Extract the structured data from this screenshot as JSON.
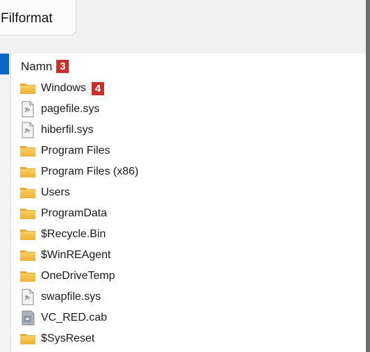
{
  "tab": {
    "label": "Filformat"
  },
  "list": {
    "column_header": "Namn",
    "header_badge": "3",
    "first_item_badge": "4",
    "items": [
      {
        "name": "Windows",
        "icon": "folder-icon"
      },
      {
        "name": "pagefile.sys",
        "icon": "system-file-icon"
      },
      {
        "name": "hiberfil.sys",
        "icon": "system-file-icon"
      },
      {
        "name": "Program Files",
        "icon": "folder-icon"
      },
      {
        "name": "Program Files (x86)",
        "icon": "folder-icon"
      },
      {
        "name": "Users",
        "icon": "folder-icon"
      },
      {
        "name": "ProgramData",
        "icon": "folder-icon"
      },
      {
        "name": "$Recycle.Bin",
        "icon": "folder-icon"
      },
      {
        "name": "$WinREAgent",
        "icon": "folder-icon"
      },
      {
        "name": "OneDriveTemp",
        "icon": "folder-icon"
      },
      {
        "name": "swapfile.sys",
        "icon": "system-file-icon"
      },
      {
        "name": "VC_RED.cab",
        "icon": "cabinet-file-icon"
      },
      {
        "name": "$SysReset",
        "icon": "folder-icon"
      }
    ]
  },
  "colors": {
    "badge": "#c9302c",
    "selection": "#0a66c8",
    "folder": "#f4c04b"
  }
}
